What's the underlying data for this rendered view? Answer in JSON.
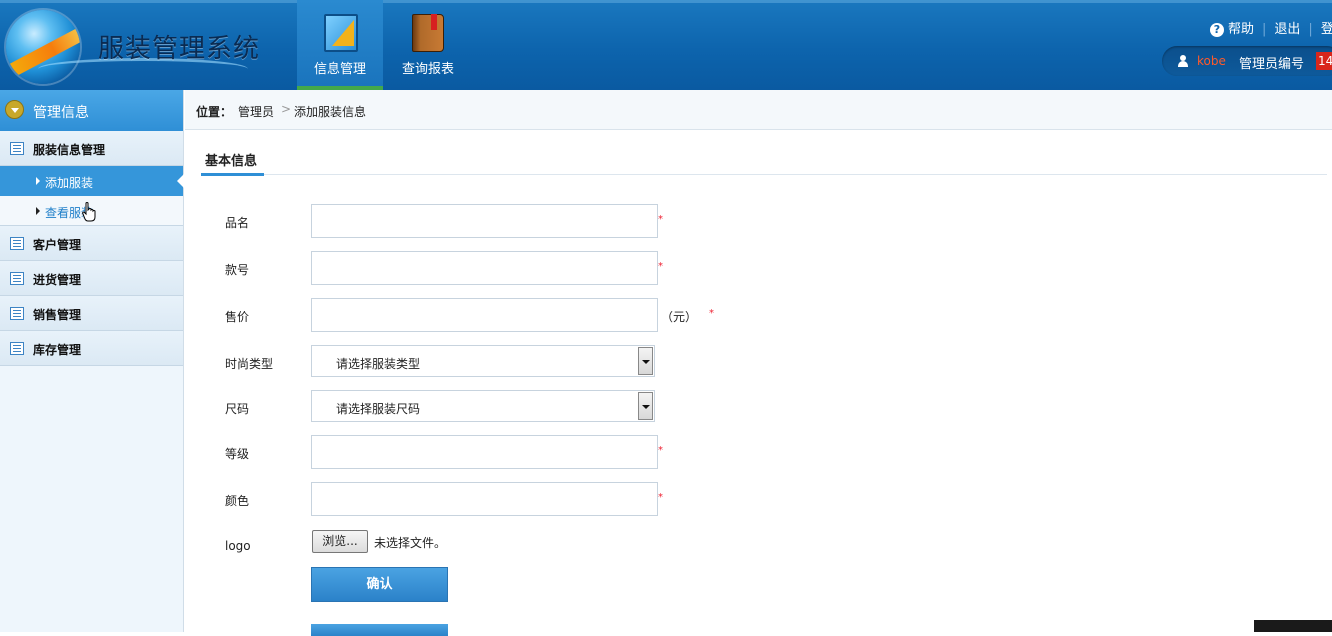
{
  "app": {
    "title": "服装管理系统"
  },
  "nav": [
    {
      "label": "信息管理",
      "icon": "ruler-triangle-icon"
    },
    {
      "label": "查询报表",
      "icon": "book-icon"
    }
  ],
  "top_links": {
    "help": "帮助",
    "logout": "退出",
    "login": "登"
  },
  "user": {
    "name": "kobe",
    "label": "管理员编号",
    "badge": "14"
  },
  "sidebar": {
    "header": "管理信息",
    "groups": [
      {
        "label": "服装信息管理",
        "items": [
          {
            "label": "添加服装",
            "active": true
          },
          {
            "label": "查看服装",
            "active": false
          }
        ]
      },
      {
        "label": "客户管理"
      },
      {
        "label": "进货管理"
      },
      {
        "label": "销售管理"
      },
      {
        "label": "库存管理"
      }
    ]
  },
  "breadcrumb": {
    "prefix": "位置：",
    "items": [
      "管理员",
      "添加服装信息"
    ],
    "separator": ">"
  },
  "section": {
    "title": "基本信息"
  },
  "form": {
    "name_label": "品名",
    "code_label": "款号",
    "price_label": "售价",
    "price_unit": "（元）",
    "type_label": "时尚类型",
    "type_placeholder": "请选择服装类型",
    "size_label": "尺码",
    "size_placeholder": "请选择服装尺码",
    "grade_label": "等级",
    "color_label": "颜色",
    "logo_label": "logo",
    "browse_label": "浏览...",
    "no_file": "未选择文件。",
    "required_mark": "*",
    "submit_label": "确认"
  },
  "colors": {
    "header": "#0d64ad",
    "accent": "#2f8fd6",
    "required": "#e22233"
  }
}
